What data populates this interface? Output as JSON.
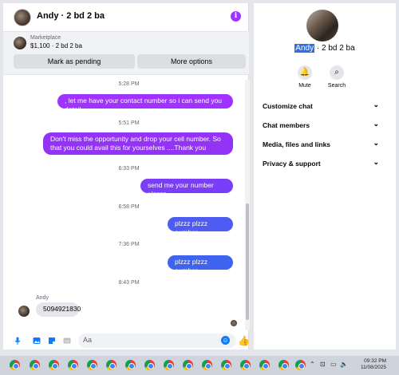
{
  "header": {
    "title": "Andy · 2 bd 2 ba",
    "info_icon": "info-icon"
  },
  "listing": {
    "label": "Marketplace",
    "price": "$1,100 · 2 bd 2 ba",
    "pending_button": "Mark as pending",
    "more_button": "More options"
  },
  "messages": {
    "t1": "5:28 PM",
    "m1": ", let me have your contact number so i can send you detail",
    "t2": "5:51 PM",
    "m2": "Don't miss the opportunity and drop your cell number. So that you could  avail this for yourselves ....Thank you",
    "t3": "6:33 PM",
    "m3": "send me your number plzzzz",
    "t4": "6:58 PM",
    "m4": "plzzz plzzz number",
    "t5": "7:36 PM",
    "m5": "plzzz plzzz number",
    "t6": "8:43 PM",
    "sender": "Andy",
    "m6": "5094921830"
  },
  "composer": {
    "placeholder": "Aa"
  },
  "panel": {
    "name_highlight": "Andy",
    "name_rest": " · 2 bd 2 ba",
    "mute": "Mute",
    "search": "Search",
    "rows": [
      "Customize chat",
      "Chat members",
      "Media, files and links",
      "Privacy & support"
    ]
  },
  "taskbar": {
    "time": "09:32 PM",
    "date": "11/08/2025",
    "tray": "ENG"
  },
  "colors": {
    "accent": "#a033ff",
    "blue": "#0a7cff"
  }
}
